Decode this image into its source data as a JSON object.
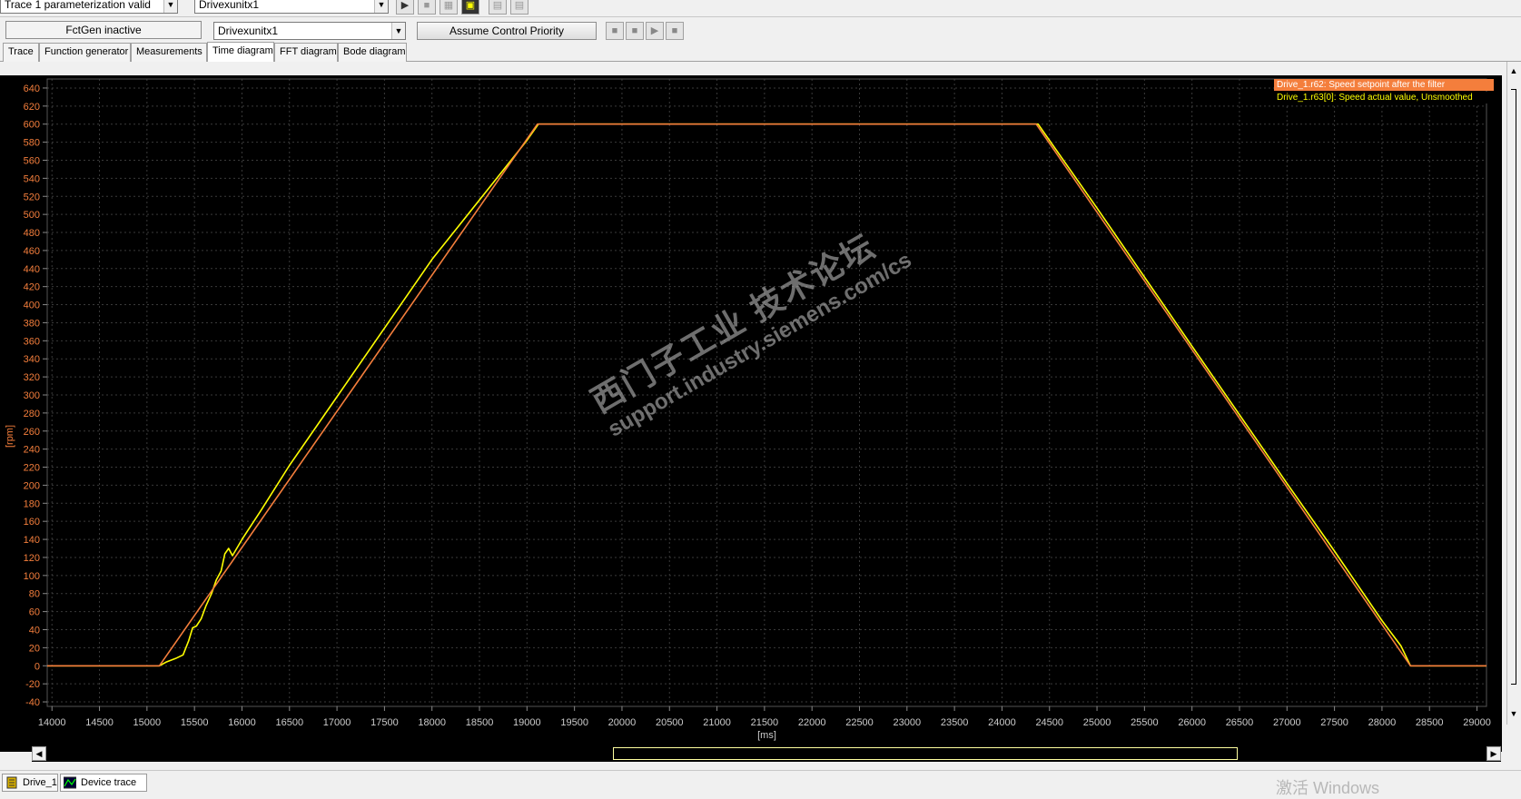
{
  "toolbar": {
    "trace_status": "Trace 1 parameterization valid",
    "drive_top": "Drivexunitx1",
    "fctgen_status": "FctGen  inactive",
    "drive_select": "Drivexunitx1",
    "assume_control": "Assume Control Priority"
  },
  "tabs": [
    "Trace",
    "Function generator",
    "Measurements",
    "Time diagram",
    "FFT diagram",
    "Bode diagram"
  ],
  "active_tab": "Time diagram",
  "legend": [
    {
      "label": "Drive_1.r62: Speed setpoint after the filter",
      "color": "#f47e3c"
    },
    {
      "label": "Drive_1.r63[0]: Speed actual value, Unsmoothed",
      "color": "#ffff00"
    }
  ],
  "watermark": {
    "line1": "西门子工业  技术论坛",
    "line2": "support.industry.siemens.com/cs"
  },
  "status_tabs": [
    "Drive_1",
    "Device trace"
  ],
  "os_overlay": "激活 Windows",
  "colors": {
    "background": "#000000",
    "grid": "#3a3a3a",
    "axis_text": "#f47e3c",
    "setpoint": "#f47e3c",
    "actual": "#ffff00"
  },
  "chart_data": {
    "type": "line",
    "xlabel": "[ms]",
    "ylabel": "[rpm]",
    "xlim": [
      13950,
      29100
    ],
    "ylim": [
      -45,
      650
    ],
    "xticks": [
      14000,
      14500,
      15000,
      15500,
      16000,
      16500,
      17000,
      17500,
      18000,
      18500,
      19000,
      19500,
      20000,
      20500,
      21000,
      21500,
      22000,
      22500,
      23000,
      23500,
      24000,
      24500,
      25000,
      25500,
      26000,
      26500,
      27000,
      27500,
      28000,
      28500,
      29000
    ],
    "yticks": [
      -40,
      -20,
      0,
      20,
      40,
      60,
      80,
      100,
      120,
      140,
      160,
      180,
      200,
      220,
      240,
      260,
      280,
      300,
      320,
      340,
      360,
      380,
      400,
      420,
      440,
      460,
      480,
      500,
      520,
      540,
      560,
      580,
      600,
      620,
      640
    ],
    "grid": true,
    "legend_position": "top-right",
    "series": [
      {
        "name": "Drive_1.r62: Speed setpoint after the filter",
        "x": [
          13950,
          15130,
          19110,
          24360,
          28300,
          29100
        ],
        "y": [
          0,
          0,
          600,
          600,
          0,
          0
        ]
      },
      {
        "name": "Drive_1.r63[0]: Speed actual value, Unsmoothed",
        "x": [
          13950,
          15130,
          15200,
          15300,
          15380,
          15440,
          15480,
          15520,
          15570,
          15620,
          15680,
          15730,
          15780,
          15820,
          15860,
          15900,
          16000,
          16200,
          16500,
          17000,
          18000,
          19000,
          19120,
          24380,
          25000,
          26000,
          27000,
          27500,
          28000,
          28200,
          28300,
          29100
        ],
        "y": [
          0,
          0,
          4,
          8,
          12,
          28,
          42,
          44,
          52,
          66,
          80,
          95,
          105,
          124,
          130,
          122,
          140,
          172,
          222,
          298,
          450,
          582,
          600,
          600,
          507,
          354,
          202,
          127,
          50,
          22,
          0,
          0
        ]
      }
    ]
  }
}
